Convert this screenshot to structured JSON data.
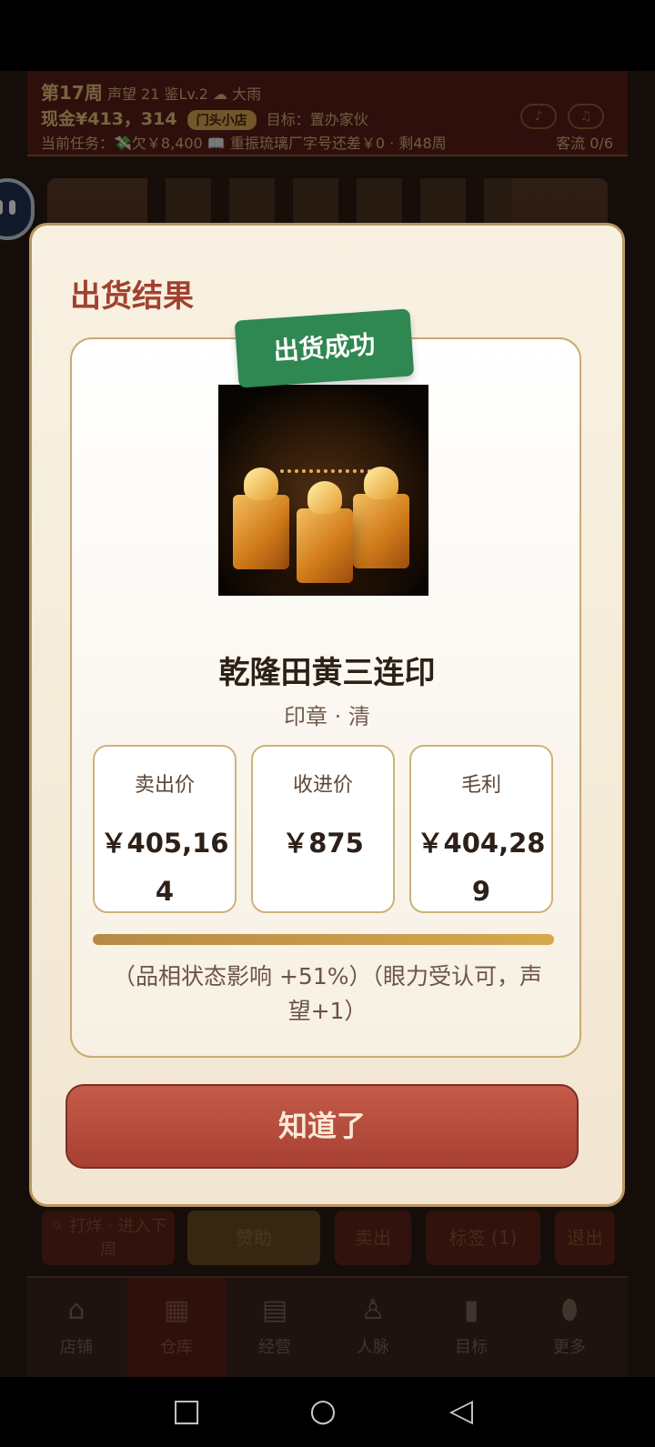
{
  "hud": {
    "week": "第17周",
    "reputation": "声望 21",
    "appraisal": "鉴Lv.2",
    "weather_icon": "rain-cloud",
    "weather": "大雨",
    "cash": "现金¥413，314",
    "shop_level": "门头小店",
    "goal": "目标：置办家伙",
    "task": "当前任务：💸欠￥8,400  📖 重振琉璃厂字号还差￥0 · 剩48周",
    "customers": "客流 0/6",
    "sound_icon": "speaker",
    "music_icon": "note"
  },
  "background_actions": {
    "next_week": "打烊 · 进入下周",
    "sponsor": "赞助",
    "sell": "卖出",
    "bid": "标签 (1)",
    "exit": "退出"
  },
  "tabs": [
    {
      "icon": "shop-icon",
      "label": "店铺"
    },
    {
      "icon": "warehouse-icon",
      "label": "仓库"
    },
    {
      "icon": "operations-icon",
      "label": "经营"
    },
    {
      "icon": "people-icon",
      "label": "人脉"
    },
    {
      "icon": "target-icon",
      "label": "目标"
    },
    {
      "icon": "more-icon",
      "label": "更多"
    }
  ],
  "modal": {
    "title": "出货结果",
    "badge": "出货成功",
    "item_name": "乾隆田黄三连印",
    "item_category": "印章 · 清",
    "prices": [
      {
        "label": "卖出价",
        "value": "￥405,164"
      },
      {
        "label": "收进价",
        "value": "￥875"
      },
      {
        "label": "毛利",
        "value": "￥404,289"
      }
    ],
    "progress_fraction": 1,
    "notes": "（品相状态影响 +51%）（眼力受认可，声望+1）",
    "button": "知道了"
  },
  "colors": {
    "accent_red": "#a84033",
    "success_green": "#2f8751",
    "gold": "#d7a84d"
  }
}
